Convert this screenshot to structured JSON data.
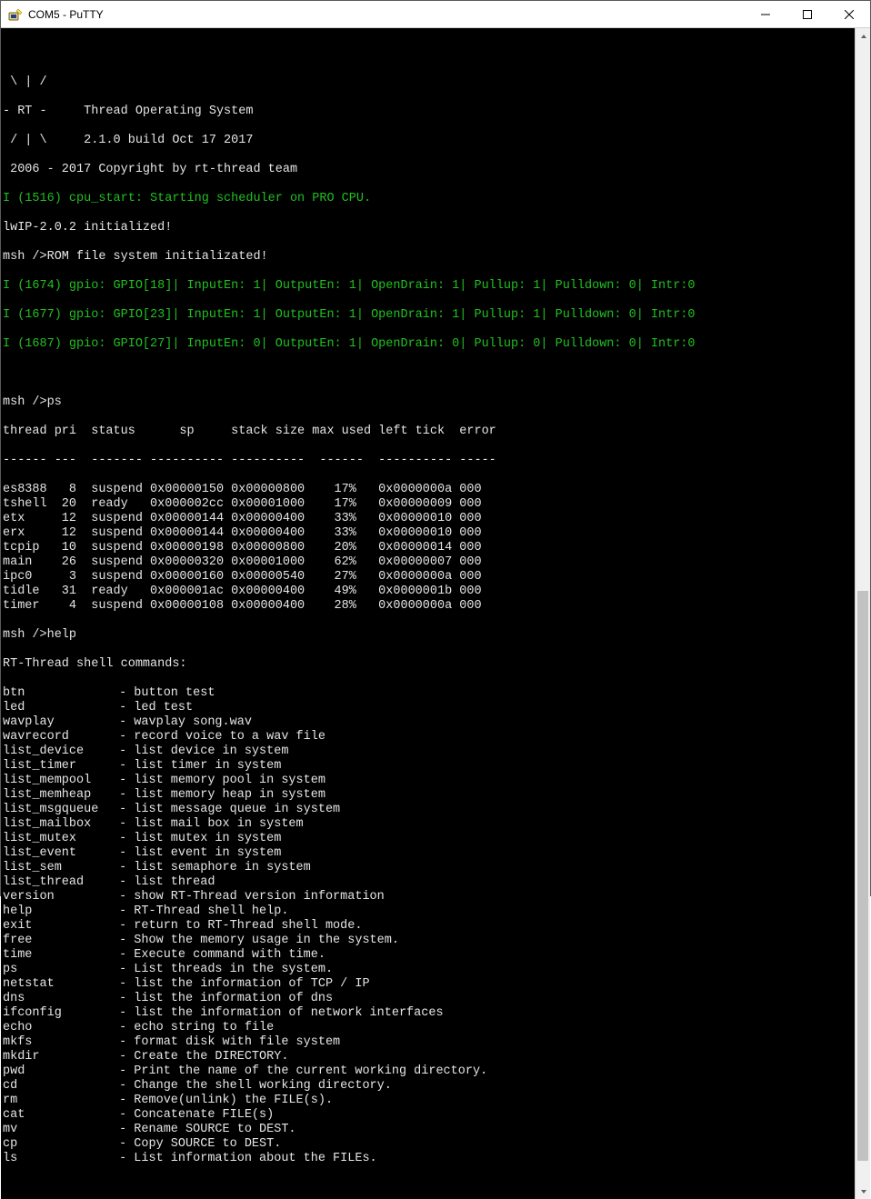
{
  "window": {
    "title": "COM5 - PuTTY"
  },
  "banner": {
    "l1": " \\ | /",
    "l2": "- RT -     Thread Operating System",
    "l3": " / | \\     2.1.0 build Oct 17 2017",
    "l4": " 2006 - 2017 Copyright by rt-thread team"
  },
  "log": {
    "sched": "I (1516) cpu_start: Starting scheduler on PRO CPU.",
    "lwip": "lwIP-2.0.2 initialized!",
    "romfs": "msh />ROM file system initializated!",
    "gpio1": "I (1674) gpio: GPIO[18]| InputEn: 1| OutputEn: 1| OpenDrain: 1| Pullup: 1| Pulldown: 0| Intr:0",
    "gpio2": "I (1677) gpio: GPIO[23]| InputEn: 1| OutputEn: 1| OpenDrain: 1| Pullup: 1| Pulldown: 0| Intr:0",
    "gpio3": "I (1687) gpio: GPIO[27]| InputEn: 0| OutputEn: 1| OpenDrain: 0| Pullup: 0| Pulldown: 0| Intr:0"
  },
  "ps": {
    "prompt": "msh />ps",
    "header": "thread pri  status      sp     stack size max used left tick  error",
    "divider": "------ ---  ------- ---------- ----------  ------  ---------- -----",
    "rows": [
      "es8388   8  suspend 0x00000150 0x00000800    17%   0x0000000a 000",
      "tshell  20  ready   0x000002cc 0x00001000    17%   0x00000009 000",
      "etx     12  suspend 0x00000144 0x00000400    33%   0x00000010 000",
      "erx     12  suspend 0x00000144 0x00000400    33%   0x00000010 000",
      "tcpip   10  suspend 0x00000198 0x00000800    20%   0x00000014 000",
      "main    26  suspend 0x00000320 0x00001000    62%   0x00000007 000",
      "ipc0     3  suspend 0x00000160 0x00000540    27%   0x0000000a 000",
      "tidle   31  ready   0x000001ac 0x00000400    49%   0x0000001b 000",
      "timer    4  suspend 0x00000108 0x00000400    28%   0x0000000a 000"
    ]
  },
  "help": {
    "prompt": "msh />help",
    "header": "RT-Thread shell commands:",
    "cmds": [
      {
        "name": "btn",
        "desc": "- button test"
      },
      {
        "name": "led",
        "desc": "- led test"
      },
      {
        "name": "wavplay",
        "desc": "- wavplay song.wav"
      },
      {
        "name": "wavrecord",
        "desc": "- record voice to a wav file"
      },
      {
        "name": "list_device",
        "desc": "- list device in system"
      },
      {
        "name": "list_timer",
        "desc": "- list timer in system"
      },
      {
        "name": "list_mempool",
        "desc": "- list memory pool in system"
      },
      {
        "name": "list_memheap",
        "desc": "- list memory heap in system"
      },
      {
        "name": "list_msgqueue",
        "desc": "- list message queue in system"
      },
      {
        "name": "list_mailbox",
        "desc": "- list mail box in system"
      },
      {
        "name": "list_mutex",
        "desc": "- list mutex in system"
      },
      {
        "name": "list_event",
        "desc": "- list event in system"
      },
      {
        "name": "list_sem",
        "desc": "- list semaphore in system"
      },
      {
        "name": "list_thread",
        "desc": "- list thread"
      },
      {
        "name": "version",
        "desc": "- show RT-Thread version information"
      },
      {
        "name": "help",
        "desc": "- RT-Thread shell help."
      },
      {
        "name": "exit",
        "desc": "- return to RT-Thread shell mode."
      },
      {
        "name": "free",
        "desc": "- Show the memory usage in the system."
      },
      {
        "name": "time",
        "desc": "- Execute command with time."
      },
      {
        "name": "ps",
        "desc": "- List threads in the system."
      },
      {
        "name": "netstat",
        "desc": "- list the information of TCP / IP"
      },
      {
        "name": "dns",
        "desc": "- list the information of dns"
      },
      {
        "name": "ifconfig",
        "desc": "- list the information of network interfaces"
      },
      {
        "name": "echo",
        "desc": "- echo string to file"
      },
      {
        "name": "mkfs",
        "desc": "- format disk with file system"
      },
      {
        "name": "mkdir",
        "desc": "- Create the DIRECTORY."
      },
      {
        "name": "pwd",
        "desc": "- Print the name of the current working directory."
      },
      {
        "name": "cd",
        "desc": "- Change the shell working directory."
      },
      {
        "name": "rm",
        "desc": "- Remove(unlink) the FILE(s)."
      },
      {
        "name": "cat",
        "desc": "- Concatenate FILE(s)"
      },
      {
        "name": "mv",
        "desc": "- Rename SOURCE to DEST."
      },
      {
        "name": "cp",
        "desc": "- Copy SOURCE to DEST."
      },
      {
        "name": "ls",
        "desc": "- List information about the FILEs."
      }
    ]
  }
}
